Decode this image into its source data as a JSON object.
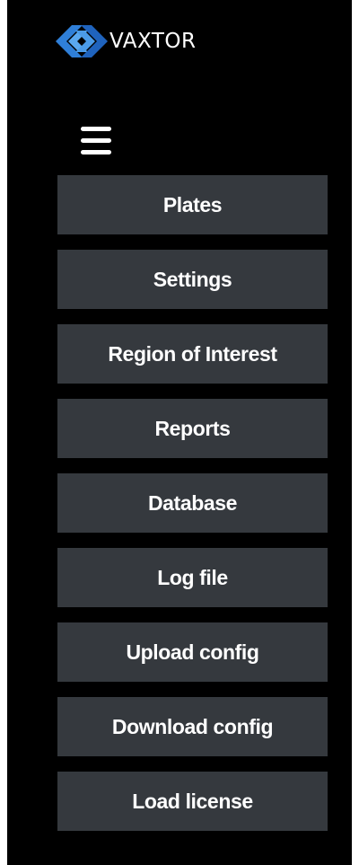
{
  "app": {
    "brand_name": "VAXTOR",
    "logo_icon": "vaxtor-logo-icon",
    "menu_icon": "hamburger-menu-icon"
  },
  "colors": {
    "sidebar_background": "#000000",
    "button_background": "#35393e",
    "button_text": "#ffffff",
    "logo_blue_light": "#3a8fe6",
    "logo_blue_dark": "#1a5fb4"
  },
  "menu": {
    "items": [
      {
        "label": "Plates"
      },
      {
        "label": "Settings"
      },
      {
        "label": "Region of Interest"
      },
      {
        "label": "Reports"
      },
      {
        "label": "Database"
      },
      {
        "label": "Log file"
      },
      {
        "label": "Upload config"
      },
      {
        "label": "Download config"
      },
      {
        "label": "Load license"
      }
    ]
  }
}
